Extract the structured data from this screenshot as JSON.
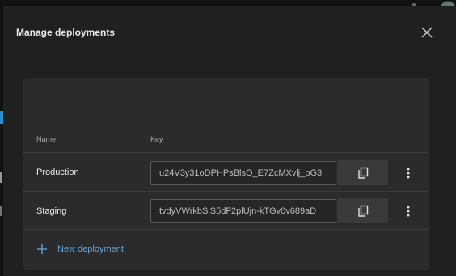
{
  "dialog": {
    "title": "Manage deployments"
  },
  "table": {
    "columns": [
      "Name",
      "Key"
    ],
    "rows": [
      {
        "name": "Production",
        "key": "u24V3y31oDPHPsBlsO_E7ZcMXvlj_pG3"
      },
      {
        "name": "Staging",
        "key": "tvdyVWrkbSlS5dF2plUjn-kTGv0v689aD"
      }
    ]
  },
  "actions": {
    "new_deployment_label": "New deployment"
  },
  "icons": {
    "close": "close-icon",
    "copy": "copy-icon",
    "more": "more-vertical-icon",
    "add": "plus-icon"
  },
  "colors": {
    "dialog_bg": "#202020",
    "card_bg": "#2b2b2b",
    "accent": "#56a8ea"
  }
}
